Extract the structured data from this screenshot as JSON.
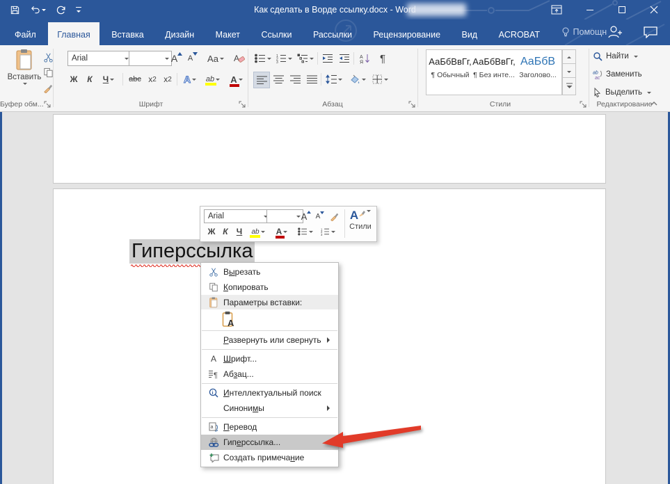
{
  "title_bar": {
    "title": "Как сделать в Ворде ссылку.docx - Word"
  },
  "tabs": {
    "file": "Файл",
    "home": "Главная",
    "insert": "Вставка",
    "design": "Дизайн",
    "layout": "Макет",
    "references": "Ссылки",
    "mailings": "Рассылки",
    "review": "Рецензирование",
    "view": "Вид",
    "acrobat": "ACROBAT",
    "assistant": "Помощн"
  },
  "ribbon": {
    "clipboard": {
      "paste": "Вставить",
      "label": "Буфер обм..."
    },
    "font": {
      "name": "Arial",
      "size": "",
      "bold": "Ж",
      "italic": "К",
      "underline": "Ч",
      "strikethrough_html": "abc",
      "subscript_html": "x<sub>2</sub>",
      "superscript_html": "x<sup>2</sup>",
      "case": "Aa",
      "effects": "А",
      "highlight": "ab",
      "color": "А",
      "label": "Шрифт"
    },
    "paragraph": {
      "sort": "АЯ",
      "pilcrow": "¶",
      "label": "Абзац"
    },
    "styles": {
      "label": "Стили",
      "items": [
        {
          "sample": "АаБбВвГг,",
          "name": "¶ Обычный"
        },
        {
          "sample": "АаБбВвГг,",
          "name": "¶ Без инте..."
        },
        {
          "sample": "АаБбВ",
          "name": "Заголово..."
        }
      ]
    },
    "editing": {
      "find": "Найти",
      "replace": "Заменить",
      "select": "Выделить",
      "label": "Редактирование"
    }
  },
  "mini_toolbar": {
    "font_name": "Arial",
    "font_size": "",
    "bold": "Ж",
    "italic": "К",
    "underline": "Ч",
    "highlight": "ab",
    "color": "А",
    "styles_letter": "А",
    "styles": "Стили"
  },
  "document": {
    "selected_text": "Гиперссылка"
  },
  "context_menu": {
    "cut_html": "В<u>ы</u>резать",
    "copy_html": "<u>К</u>опировать",
    "paste_options_label": "Параметры вставки:",
    "expand_collapse_html": "<u>Р</u>азвернуть или свернуть",
    "font_html": "<u>Ш</u>рифт...",
    "paragraph_html": "Аб<u>з</u>ац...",
    "smart_lookup_html": "<u>И</u>нтеллектуальный поиск",
    "synonyms_html": "Синони<u>м</u>ы",
    "translate_html": "<u>П</u>еревод",
    "hyperlink_html": "Гип<u>е</u>рссылка...",
    "new_comment_html": "Создать примеча<u>н</u>ие"
  },
  "colors": {
    "titlebar_blue": "#2b579a",
    "menu_highlight": "#c9c9c9",
    "arrow_red": "#e13b29",
    "heading_style_blue": "#2e74b5",
    "highlight_yellow": "#ffff00",
    "font_color_red": "#c00000"
  }
}
